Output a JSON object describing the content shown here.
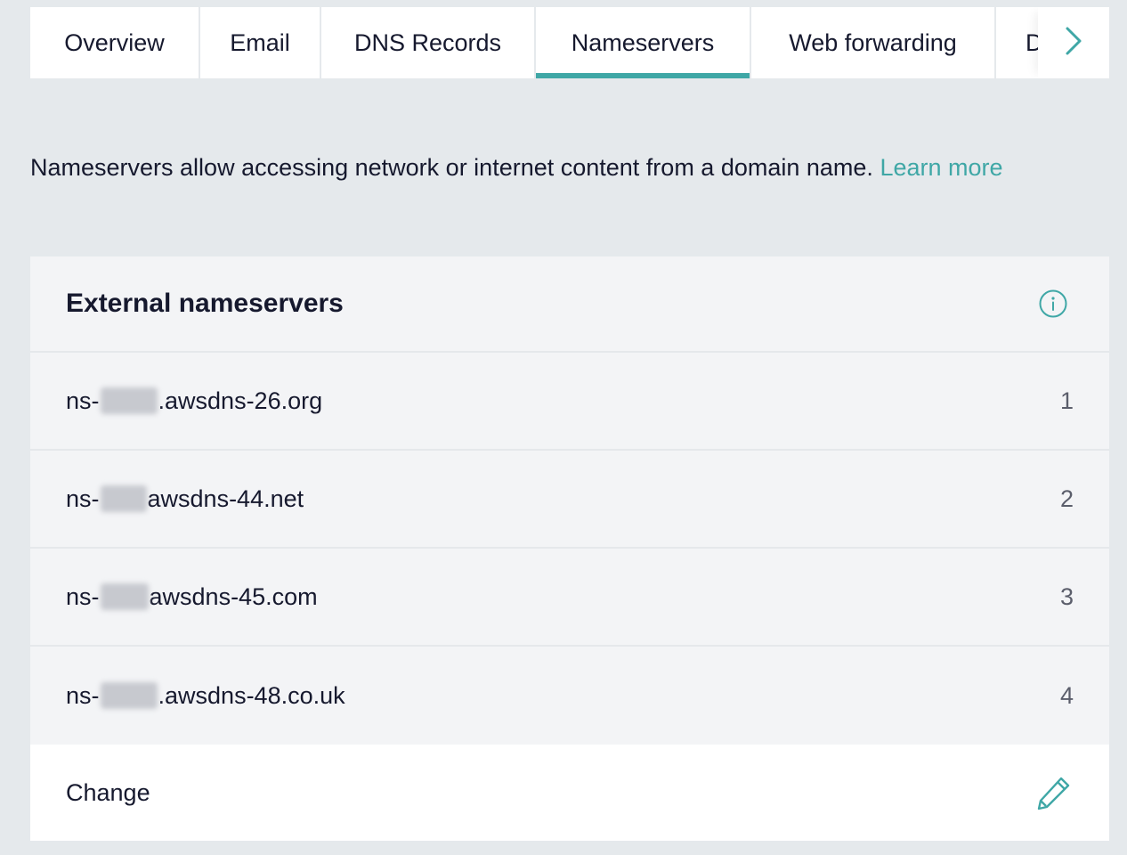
{
  "tabs": [
    {
      "label": "Overview",
      "active": false
    },
    {
      "label": "Email",
      "active": false
    },
    {
      "label": "DNS Records",
      "active": false
    },
    {
      "label": "Nameservers",
      "active": true
    },
    {
      "label": "Web forwarding",
      "active": false
    },
    {
      "label": "D",
      "active": false
    }
  ],
  "tab_scroll_icon": "chevron-right-icon",
  "description": {
    "text": "Nameservers allow accessing network or internet content from a domain name.",
    "link": "Learn more"
  },
  "card": {
    "title": "External nameservers",
    "info_icon": "info-icon",
    "nameservers": [
      {
        "prefix": "ns-",
        "suffix": ".awsdns-26.org",
        "index": "1"
      },
      {
        "prefix": "ns-",
        "suffix": "awsdns-44.net",
        "index": "2"
      },
      {
        "prefix": "ns-",
        "suffix": "awsdns-45.com",
        "index": "3"
      },
      {
        "prefix": "ns-",
        "suffix": ".awsdns-48.co.uk",
        "index": "4"
      }
    ],
    "change_label": "Change",
    "edit_icon": "pencil-icon"
  },
  "colors": {
    "accent": "#3fa7a6",
    "background": "#e5e9ec",
    "text": "#16192e"
  }
}
